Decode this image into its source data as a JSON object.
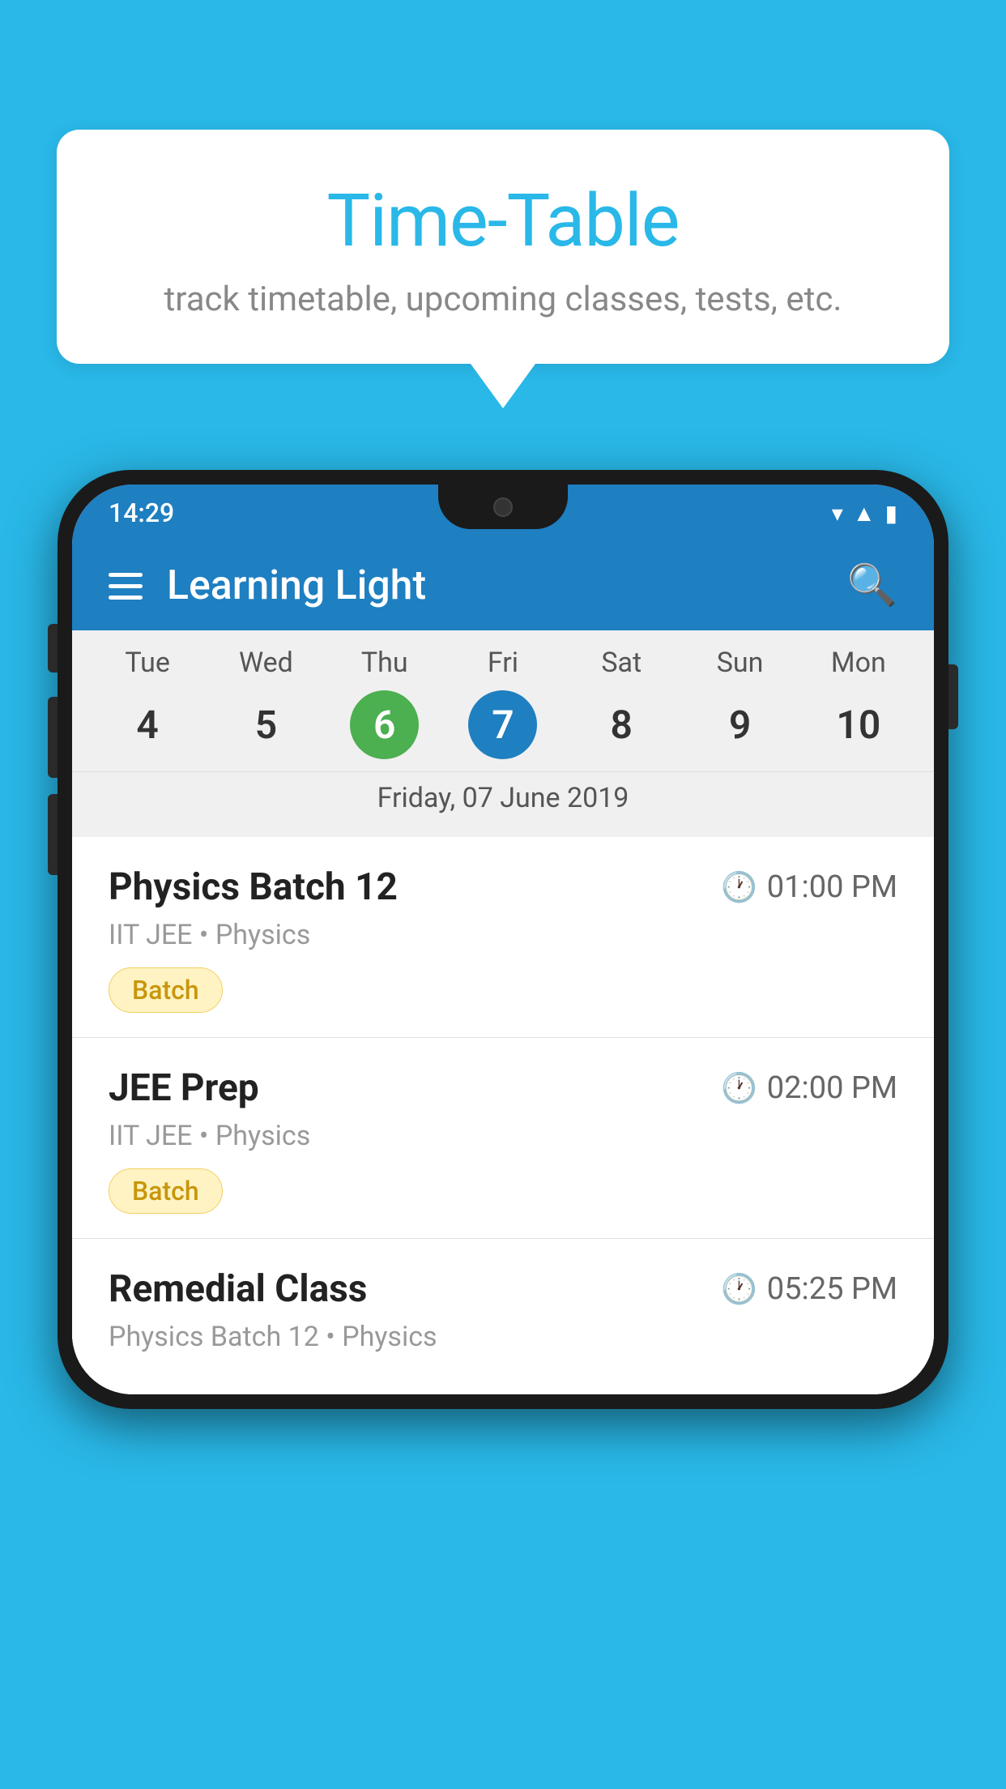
{
  "background_color": "#29B8E8",
  "speech_bubble": {
    "title": "Time-Table",
    "subtitle": "track timetable, upcoming classes, tests, etc."
  },
  "phone": {
    "status_bar": {
      "time": "14:29"
    },
    "app_header": {
      "title": "Learning Light"
    },
    "calendar": {
      "days": [
        {
          "name": "Tue",
          "num": "4",
          "state": "normal"
        },
        {
          "name": "Wed",
          "num": "5",
          "state": "normal"
        },
        {
          "name": "Thu",
          "num": "6",
          "state": "today"
        },
        {
          "name": "Fri",
          "num": "7",
          "state": "selected"
        },
        {
          "name": "Sat",
          "num": "8",
          "state": "normal"
        },
        {
          "name": "Sun",
          "num": "9",
          "state": "normal"
        },
        {
          "name": "Mon",
          "num": "10",
          "state": "normal"
        }
      ],
      "selected_date_label": "Friday, 07 June 2019"
    },
    "schedule_items": [
      {
        "name": "Physics Batch 12",
        "time": "01:00 PM",
        "meta": "IIT JEE • Physics",
        "badge": "Batch"
      },
      {
        "name": "JEE Prep",
        "time": "02:00 PM",
        "meta": "IIT JEE • Physics",
        "badge": "Batch"
      },
      {
        "name": "Remedial Class",
        "time": "05:25 PM",
        "meta": "Physics Batch 12 • Physics",
        "badge": null
      }
    ]
  },
  "labels": {
    "batch": "Batch",
    "search": "search",
    "menu": "menu"
  }
}
